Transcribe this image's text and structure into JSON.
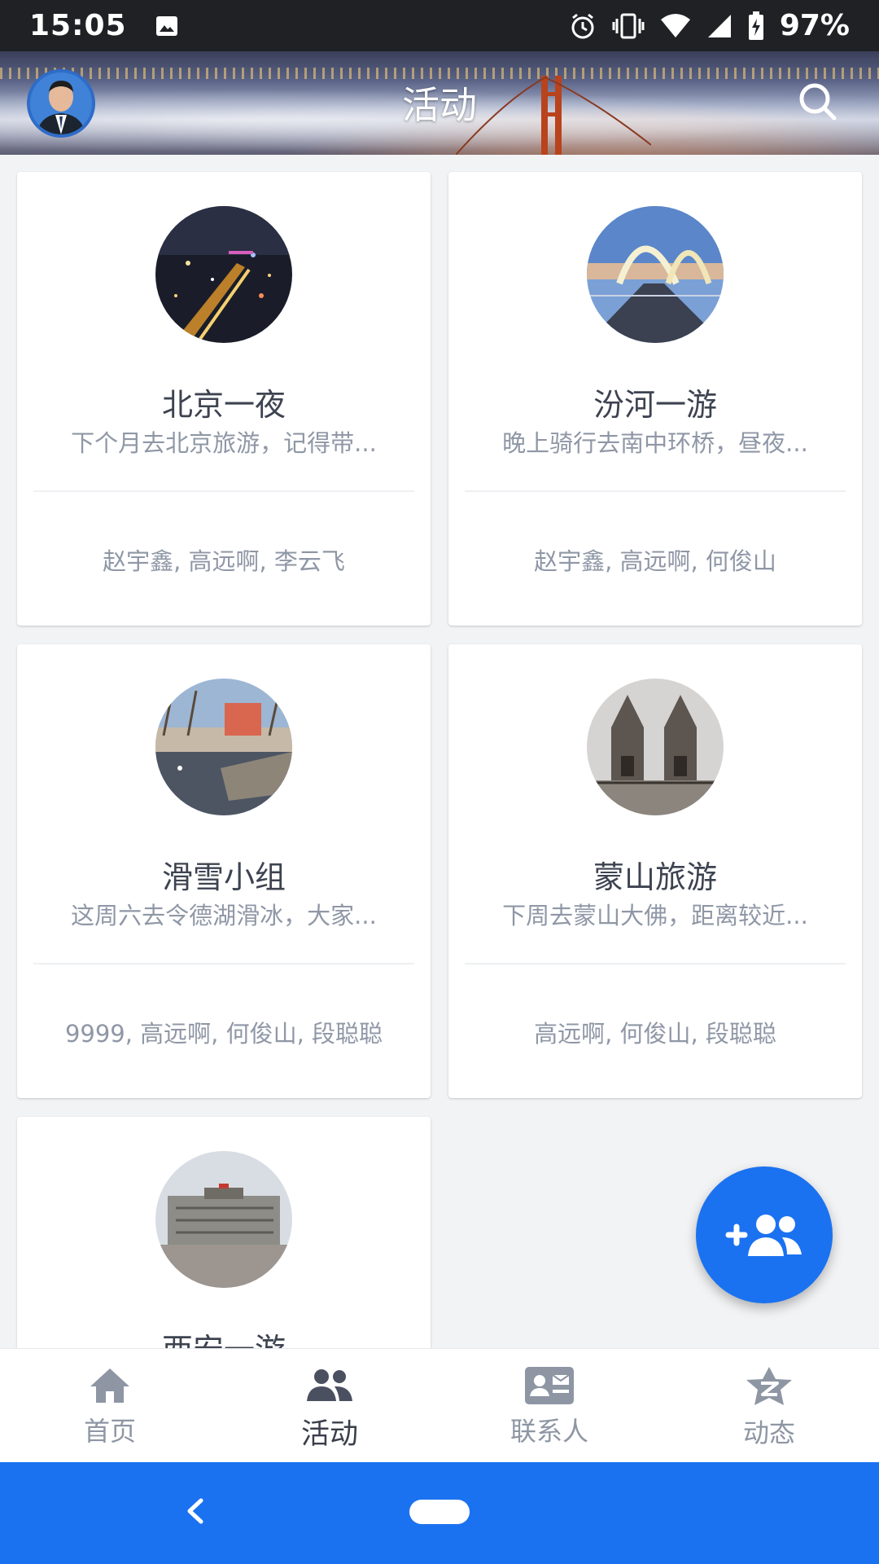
{
  "status_bar": {
    "time": "15:05",
    "battery": "97%"
  },
  "header": {
    "title": "活动"
  },
  "cards": [
    {
      "title": "北京一夜",
      "desc": "下个月去北京旅游，记得带...",
      "members": "赵宇鑫, 高远啊, 李云飞"
    },
    {
      "title": "汾河一游",
      "desc": "晚上骑行去南中环桥，昼夜...",
      "members": "赵宇鑫, 高远啊, 何俊山"
    },
    {
      "title": "滑雪小组",
      "desc": "这周六去令德湖滑冰，大家...",
      "members": "9999, 高远啊, 何俊山, 段聪聪"
    },
    {
      "title": "蒙山旅游",
      "desc": "下周去蒙山大佛，距离较近...",
      "members": "高远啊, 何俊山, 段聪聪"
    },
    {
      "title": "西安一游",
      "desc": "",
      "members": ""
    }
  ],
  "bottom_nav": [
    {
      "label": "首页",
      "icon": "home-icon"
    },
    {
      "label": "活动",
      "icon": "group-icon",
      "active": true
    },
    {
      "label": "联系人",
      "icon": "contact-card-icon"
    },
    {
      "label": "动态",
      "icon": "qzone-star-icon"
    }
  ],
  "colors": {
    "accent": "#1b72f0",
    "status_bar": "#1f2125"
  }
}
